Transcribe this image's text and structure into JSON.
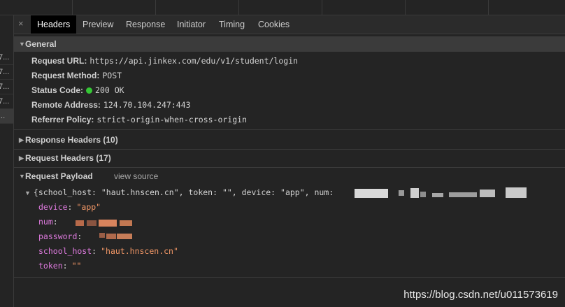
{
  "left_rows": [
    "7...",
    "7...",
    "7...",
    "7...",
    "..."
  ],
  "tabs": {
    "close": "×",
    "items": [
      "Headers",
      "Preview",
      "Response",
      "Initiator",
      "Timing",
      "Cookies"
    ]
  },
  "general": {
    "title": "General",
    "request_url_label": "Request URL:",
    "request_url": "https://api.jinkex.com/edu/v1/student/login",
    "request_method_label": "Request Method:",
    "request_method": "POST",
    "status_code_label": "Status Code:",
    "status_code": "200 OK",
    "remote_address_label": "Remote Address:",
    "remote_address": "124.70.104.247:443",
    "referrer_policy_label": "Referrer Policy:",
    "referrer_policy": "strict-origin-when-cross-origin"
  },
  "response_headers": "Response Headers (10)",
  "request_headers": "Request Headers (17)",
  "request_payload": {
    "title": "Request Payload",
    "view_source": "view source",
    "summary": "{school_host: \"haut.hnscen.cn\", token: \"\", device: \"app\", num:",
    "props": [
      {
        "key": "device",
        "value": "\"app\""
      },
      {
        "key": "num",
        "value": ""
      },
      {
        "key": "password",
        "value": ""
      },
      {
        "key": "school_host",
        "value": "\"haut.hnscen.cn\""
      },
      {
        "key": "token",
        "value": "\"\""
      }
    ]
  },
  "colors": {
    "status_ok": "#35c735",
    "prop_key": "#e07be0",
    "string_value": "#f29766"
  },
  "watermark": "https://blog.csdn.net/u011573619"
}
